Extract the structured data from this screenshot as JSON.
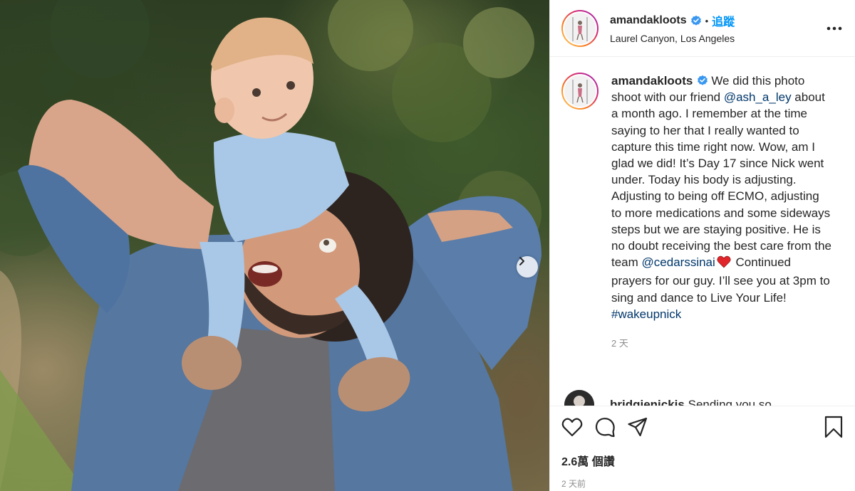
{
  "post": {
    "username": "amandakloots",
    "follow_label": "追蹤",
    "separator": "•",
    "location": "Laurel Canyon, Los Angeles",
    "icons": {
      "verified": "verified-badge-icon",
      "more": "more-options-icon",
      "next": "next-slide-icon"
    }
  },
  "caption": {
    "username": "amandakloots",
    "text_1": "We did this photo shoot with our friend ",
    "mention_1": "@ash_a_ley",
    "text_2": " about a month ago. I remember at the time saying to her that I really wanted to capture this time right now. Wow, am I glad we did! It’s Day 17 since Nick went under. Today his body is adjusting. Adjusting to being off ECMO, adjusting to more medications and some sideways steps but we are staying positive. He is no doubt receiving the best care from the team ",
    "mention_2": "@cedarssinai",
    "text_3": " Continued prayers for our guy. I’ll see you at 3pm to sing and dance to Live Your Life! ",
    "hashtag": "#wakeupnick",
    "age": "2 天"
  },
  "comment": {
    "username": "bridgienickis",
    "text": "Sending you so"
  },
  "actions": {
    "icons": [
      "heart-icon",
      "comment-icon",
      "share-icon",
      "bookmark-icon"
    ],
    "likes": "2.6萬 個讚",
    "age": "2 天前"
  },
  "colors": {
    "accent": "#0095f6",
    "link": "#00376b",
    "text": "#262626",
    "muted": "#8e8e8e",
    "heart": "#ed4956"
  }
}
